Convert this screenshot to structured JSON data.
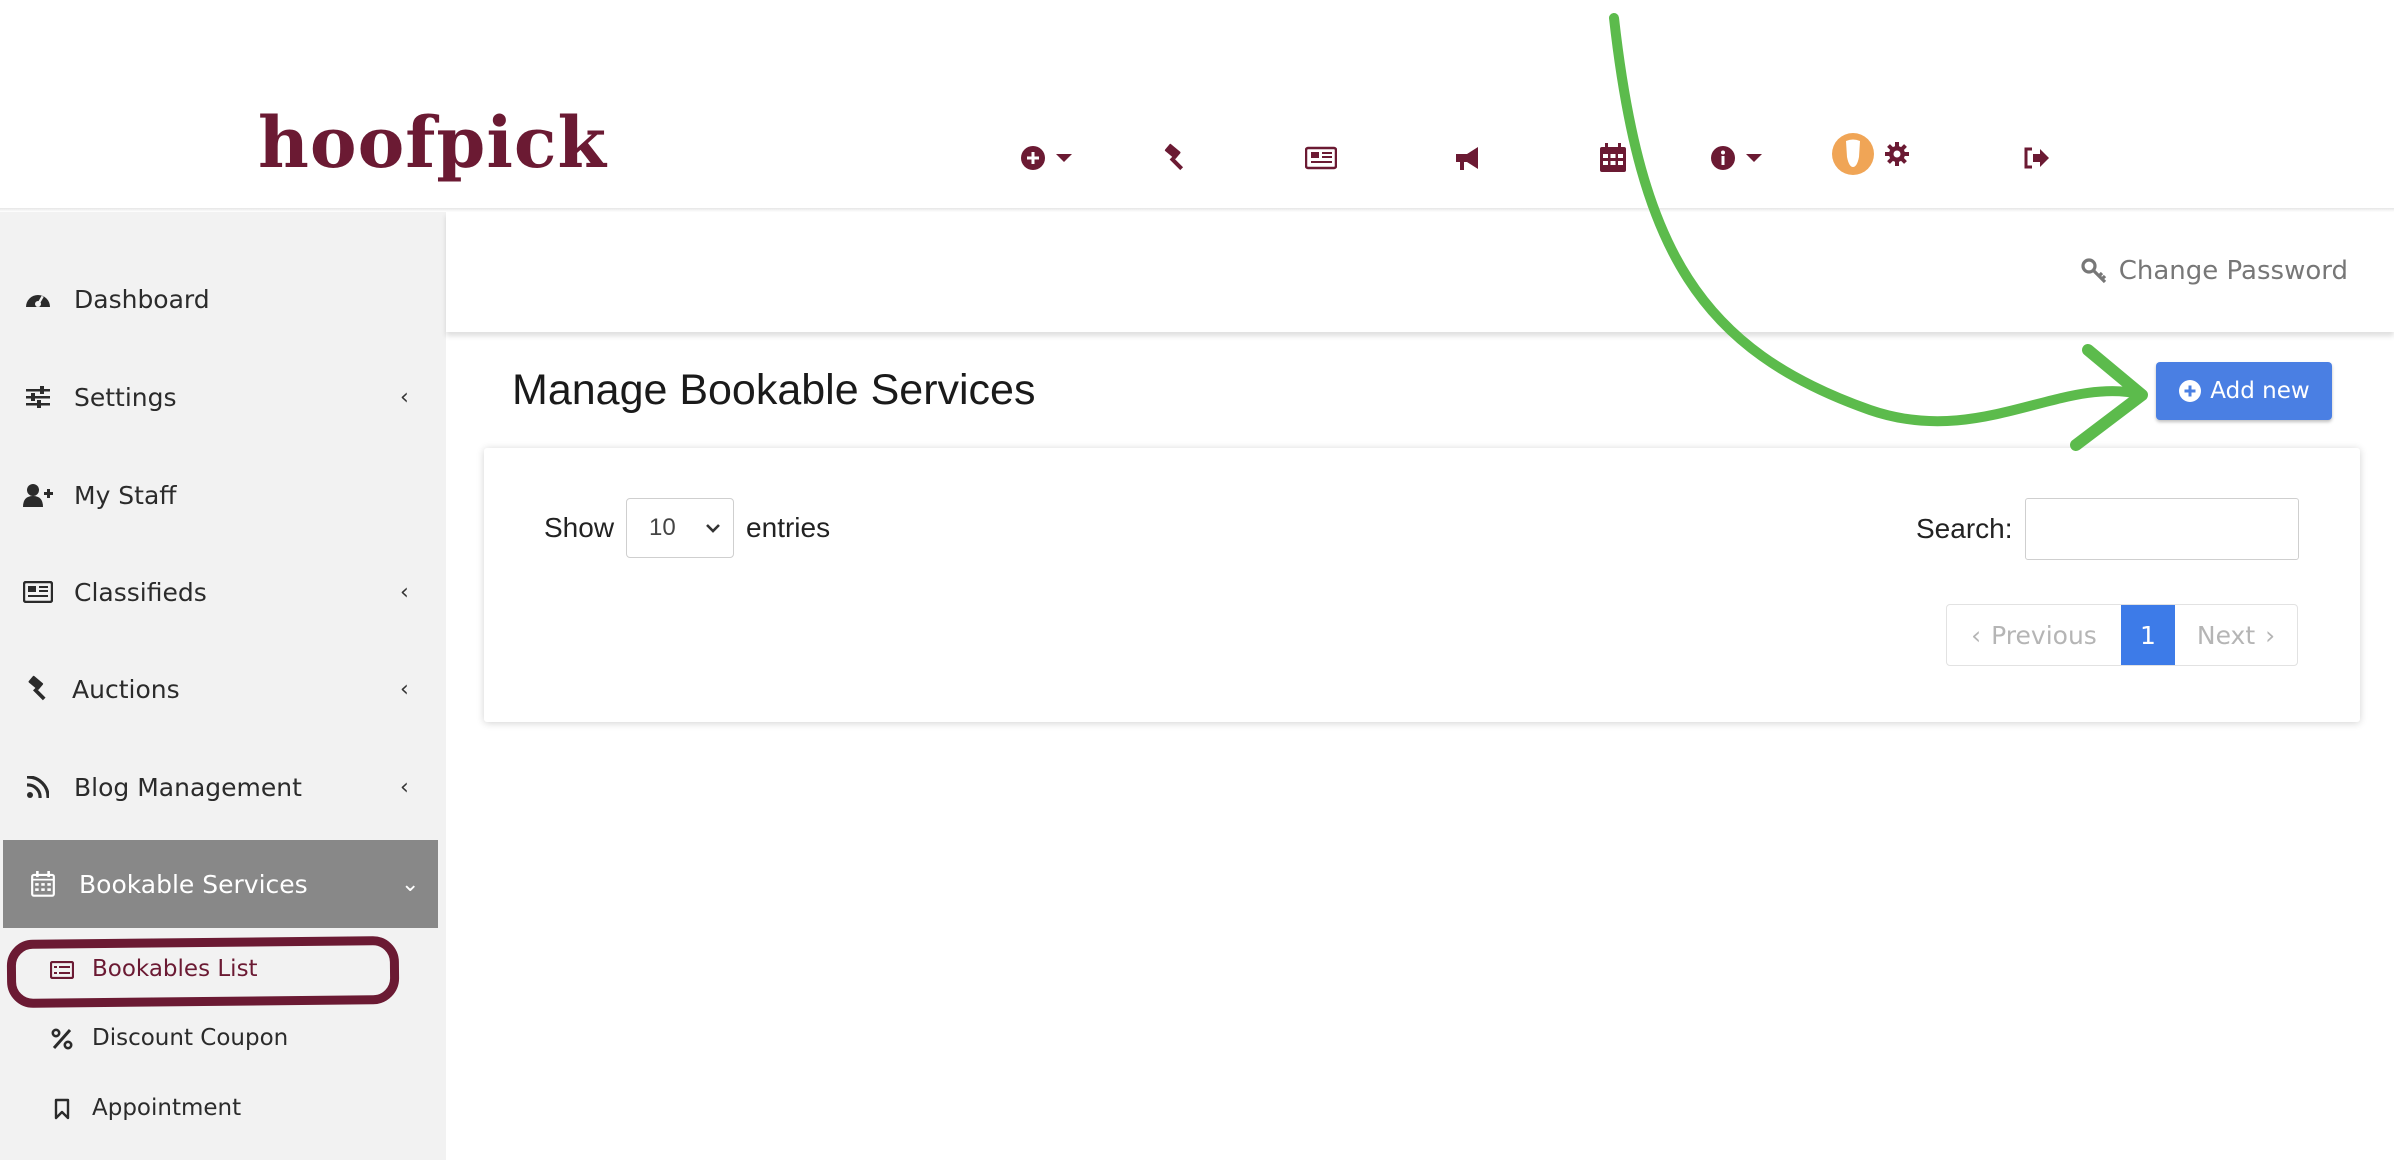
{
  "brand": {
    "logo_text": "hoofpick",
    "logo_color": "#6b1a33"
  },
  "top_nav": {
    "icons": [
      "plus-circle-icon",
      "gavel-icon",
      "newspaper-icon",
      "megaphone-icon",
      "calendar-icon",
      "info-circle-icon",
      "user-avatar-icon",
      "gear-icon",
      "logout-icon"
    ]
  },
  "subheader": {
    "change_password_label": "Change Password"
  },
  "sidebar": {
    "items": [
      {
        "label": "Dashboard",
        "icon": "dashboard-icon",
        "has_submenu": false
      },
      {
        "label": "Settings",
        "icon": "sliders-icon",
        "has_submenu": true,
        "chevron": "‹"
      },
      {
        "label": "My Staff",
        "icon": "user-plus-icon",
        "has_submenu": false
      },
      {
        "label": "Classifieds",
        "icon": "newspaper-icon",
        "has_submenu": true,
        "chevron": "‹"
      },
      {
        "label": "Auctions",
        "icon": "gavel-icon",
        "has_submenu": true,
        "chevron": "‹"
      },
      {
        "label": "Blog Management",
        "icon": "rss-icon",
        "has_submenu": true,
        "chevron": "‹"
      },
      {
        "label": "Bookable Services",
        "icon": "calendar-icon",
        "has_submenu": true,
        "expanded": true,
        "chevron": "⌄"
      }
    ],
    "subitems": [
      {
        "label": "Bookables List",
        "icon": "list-icon",
        "selected": true
      },
      {
        "label": "Discount Coupon",
        "icon": "percent-icon"
      },
      {
        "label": "Appointment",
        "icon": "bookmark-icon"
      }
    ]
  },
  "main": {
    "page_title": "Manage Bookable Services",
    "add_button_label": "Add new",
    "table_controls": {
      "show_label": "Show",
      "entries_value": "10",
      "entries_label": "entries",
      "search_label": "Search:",
      "search_value": ""
    },
    "pagination": {
      "previous_label": "Previous",
      "current_page": "1",
      "next_label": "Next"
    }
  },
  "colors": {
    "brand": "#6b1a33",
    "primary_button": "#4a7fe3",
    "active_page": "#3d7be8",
    "sidebar_bg": "#f2f2f2",
    "sidebar_active": "#888888",
    "annotation_arrow": "#5cbb4c"
  }
}
